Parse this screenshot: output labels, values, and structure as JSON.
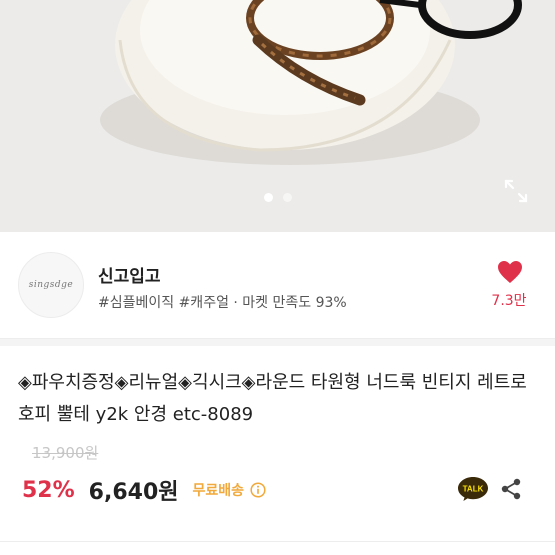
{
  "image": {
    "slide_count": 2,
    "active_slide": 1
  },
  "shop": {
    "avatar_text": "singsdge",
    "name": "신고입고",
    "tags": "#심플베이직 #캐주얼 · 마켓 만족도 93%",
    "likes": "7.3만"
  },
  "product": {
    "title": "◈파우치증정◈리뉴얼◈긱시크◈라운드 타원형 너드룩 빈티지 레트로 호피 뿔테 y2k 안경 etc-8089",
    "original_price": "13,900원",
    "discount": "52%",
    "price": "6,640원",
    "shipping": "무료배송"
  },
  "talk_label": "TALK",
  "colors": {
    "accent_red": "#e0314a",
    "shipping_orange": "#f2a93b",
    "talk_yellow": "#fae100"
  }
}
